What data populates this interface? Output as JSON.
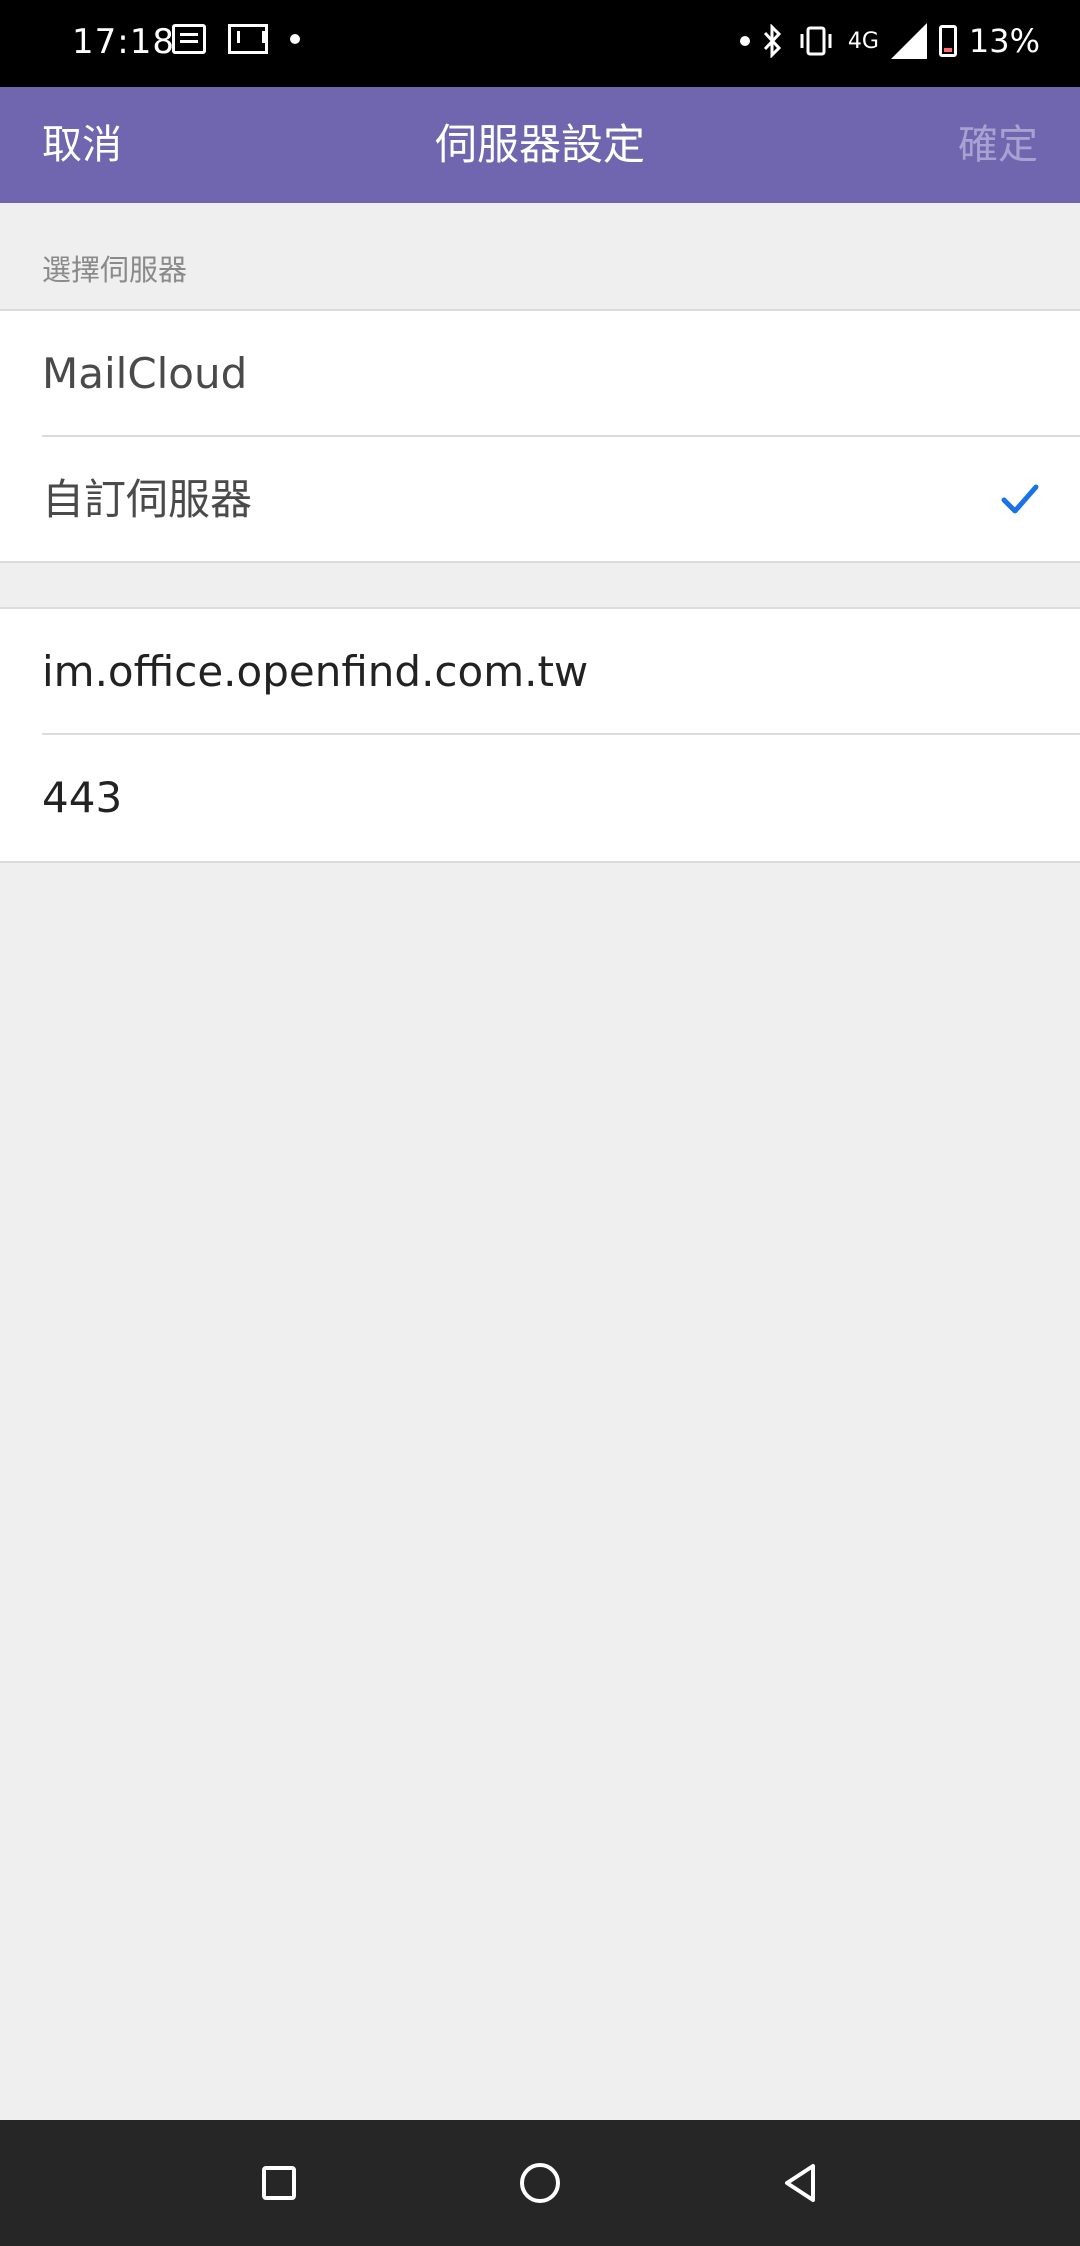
{
  "status_bar": {
    "time": "17:18",
    "network": "4G",
    "battery": "13%",
    "icons": [
      "news-icon",
      "mail-icon",
      "dot-icon",
      "bluetooth-icon",
      "vibrate-icon",
      "signal-icon",
      "battery-icon"
    ]
  },
  "nav": {
    "cancel_label": "取消",
    "title": "伺服器設定",
    "confirm_label": "確定"
  },
  "section": {
    "header": "選擇伺服器"
  },
  "server_options": [
    {
      "label": "MailCloud",
      "selected": false
    },
    {
      "label": "自訂伺服器",
      "selected": true
    }
  ],
  "custom_server": {
    "host": "im.office.openfind.com.tw",
    "port": "443"
  },
  "colors": {
    "nav_bg": "#7066b0",
    "check": "#1a73e8",
    "confirm_disabled": "#a7a2cf"
  }
}
